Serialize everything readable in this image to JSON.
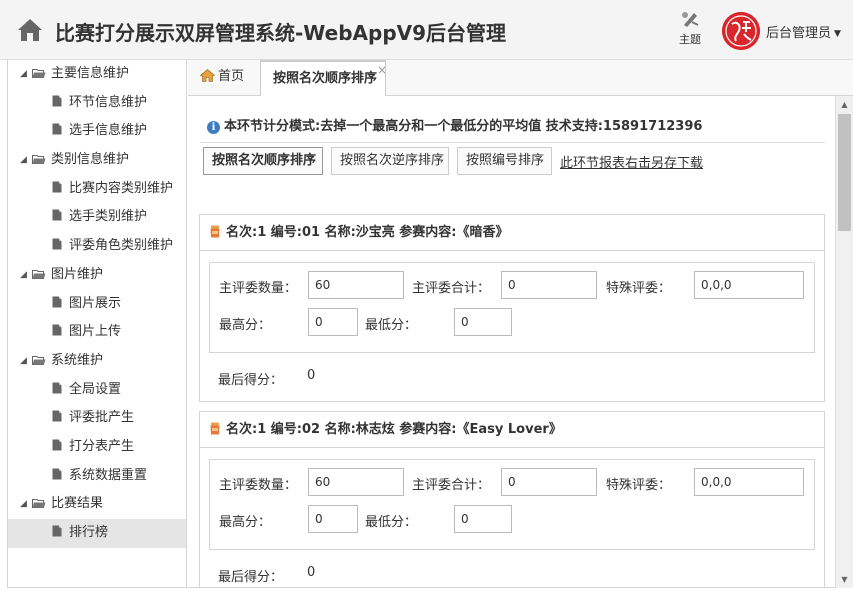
{
  "header": {
    "title": "比赛打分展示双屏管理系统-WebAppV9后台管理",
    "theme_label": "主题",
    "user_label": "后台管理员",
    "logo_text": "行易软件"
  },
  "sidebar": {
    "groups": [
      {
        "label": "主要信息维护",
        "items": [
          "环节信息维护",
          "选手信息维护"
        ]
      },
      {
        "label": "类别信息维护",
        "items": [
          "比赛内容类别维护",
          "选手类别维护",
          "评委角色类别维护"
        ]
      },
      {
        "label": "图片维护",
        "items": [
          "图片展示",
          "图片上传"
        ]
      },
      {
        "label": "系统维护",
        "items": [
          "全局设置",
          "评委批产生",
          "打分表产生",
          "系统数据重置"
        ]
      },
      {
        "label": "比赛结果",
        "items": [
          "排行榜"
        ]
      }
    ],
    "selected": "排行榜"
  },
  "tabs": {
    "home": "首页",
    "active": "按照名次顺序排序",
    "close": "×"
  },
  "content": {
    "notice": "本环节计分模式:去掉一个最高分和一个最低分的平均值 技术支持:15891712396",
    "buttons": [
      "按照名次顺序排序",
      "按照名次逆序排序",
      "按照编号排序"
    ],
    "download_link": "此环节报表右击另存下载",
    "field_labels": {
      "main_count": "主评委数量：",
      "main_total": "主评委合计：",
      "special": "特殊评委：",
      "max": "最高分：",
      "min": "最低分：",
      "final": "最后得分："
    },
    "cards": [
      {
        "title": "名次:1 编号:01 名称:沙宝亮 参赛内容:《暗香》",
        "main_count": "60",
        "main_total": "0",
        "special": "0,0,0",
        "max": "0",
        "min": "0",
        "final": "0"
      },
      {
        "title": "名次:1 编号:02 名称:林志炫 参赛内容:《Easy Lover》",
        "main_count": "60",
        "main_total": "0",
        "special": "0,0,0",
        "max": "0",
        "min": "0",
        "final": "0"
      }
    ]
  },
  "colors": {
    "accent_red": "#d8262c",
    "info_blue": "#3c7dbf",
    "selected_bg": "#e5e5e5"
  }
}
